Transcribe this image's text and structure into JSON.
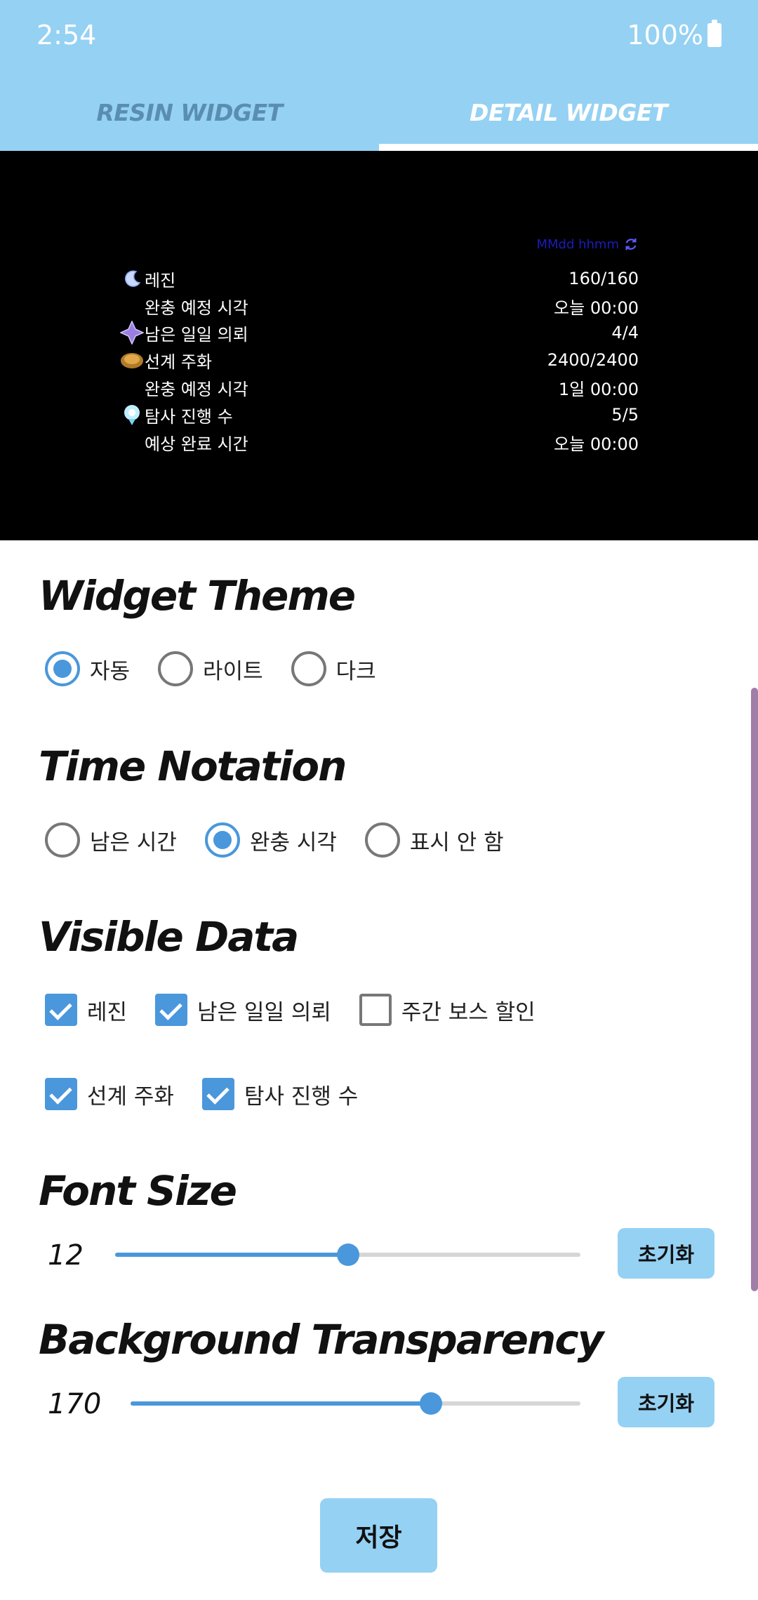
{
  "status": {
    "time": "2:54",
    "battery": "100%"
  },
  "tabs": [
    {
      "label": "RESIN WIDGET",
      "selected": false
    },
    {
      "label": "DETAIL WIDGET",
      "selected": true
    }
  ],
  "preview": {
    "title": "MMdd hhmm",
    "rows": [
      {
        "icon": "moon-icon",
        "label": "레진",
        "value": "160/160"
      },
      {
        "icon": "",
        "label": "완충 예정 시각",
        "value": "오늘 00:00"
      },
      {
        "icon": "commission-icon",
        "label": "남은 일일 의뢰",
        "value": "4/4"
      },
      {
        "icon": "coin-icon",
        "label": "선계 주화",
        "value": "2400/2400"
      },
      {
        "icon": "",
        "label": "완충 예정 시각",
        "value": "1일 00:00"
      },
      {
        "icon": "expedition-icon",
        "label": "탐사 진행 수",
        "value": "5/5"
      },
      {
        "icon": "",
        "label": "예상 완료 시간",
        "value": "오늘 00:00"
      }
    ]
  },
  "widget_theme": {
    "title": "Widget Theme",
    "options": [
      {
        "label": "자동",
        "selected": true
      },
      {
        "label": "라이트",
        "selected": false
      },
      {
        "label": "다크",
        "selected": false
      }
    ]
  },
  "time_notation": {
    "title": "Time Notation",
    "options": [
      {
        "label": "남은 시간",
        "selected": false
      },
      {
        "label": "완충 시각",
        "selected": true
      },
      {
        "label": "표시 안 함",
        "selected": false
      }
    ]
  },
  "visible_data": {
    "title": "Visible Data",
    "items": [
      {
        "label": "레진",
        "checked": true
      },
      {
        "label": "남은 일일 의뢰",
        "checked": true
      },
      {
        "label": "주간 보스 할인",
        "checked": false
      },
      {
        "label": "선계 주화",
        "checked": true
      },
      {
        "label": "탐사 진행 수",
        "checked": true
      }
    ]
  },
  "font_size": {
    "title": "Font Size",
    "value": "12",
    "fraction": 0.5,
    "reset_label": "초기화"
  },
  "background_transparency": {
    "title": "Background Transparency",
    "value": "170",
    "fraction": 0.667,
    "reset_label": "초기화"
  },
  "save_label": "저장",
  "colors": {
    "accent": "#4a97dc",
    "header": "#95d1f3",
    "scrollbar": "#a07ea8"
  }
}
